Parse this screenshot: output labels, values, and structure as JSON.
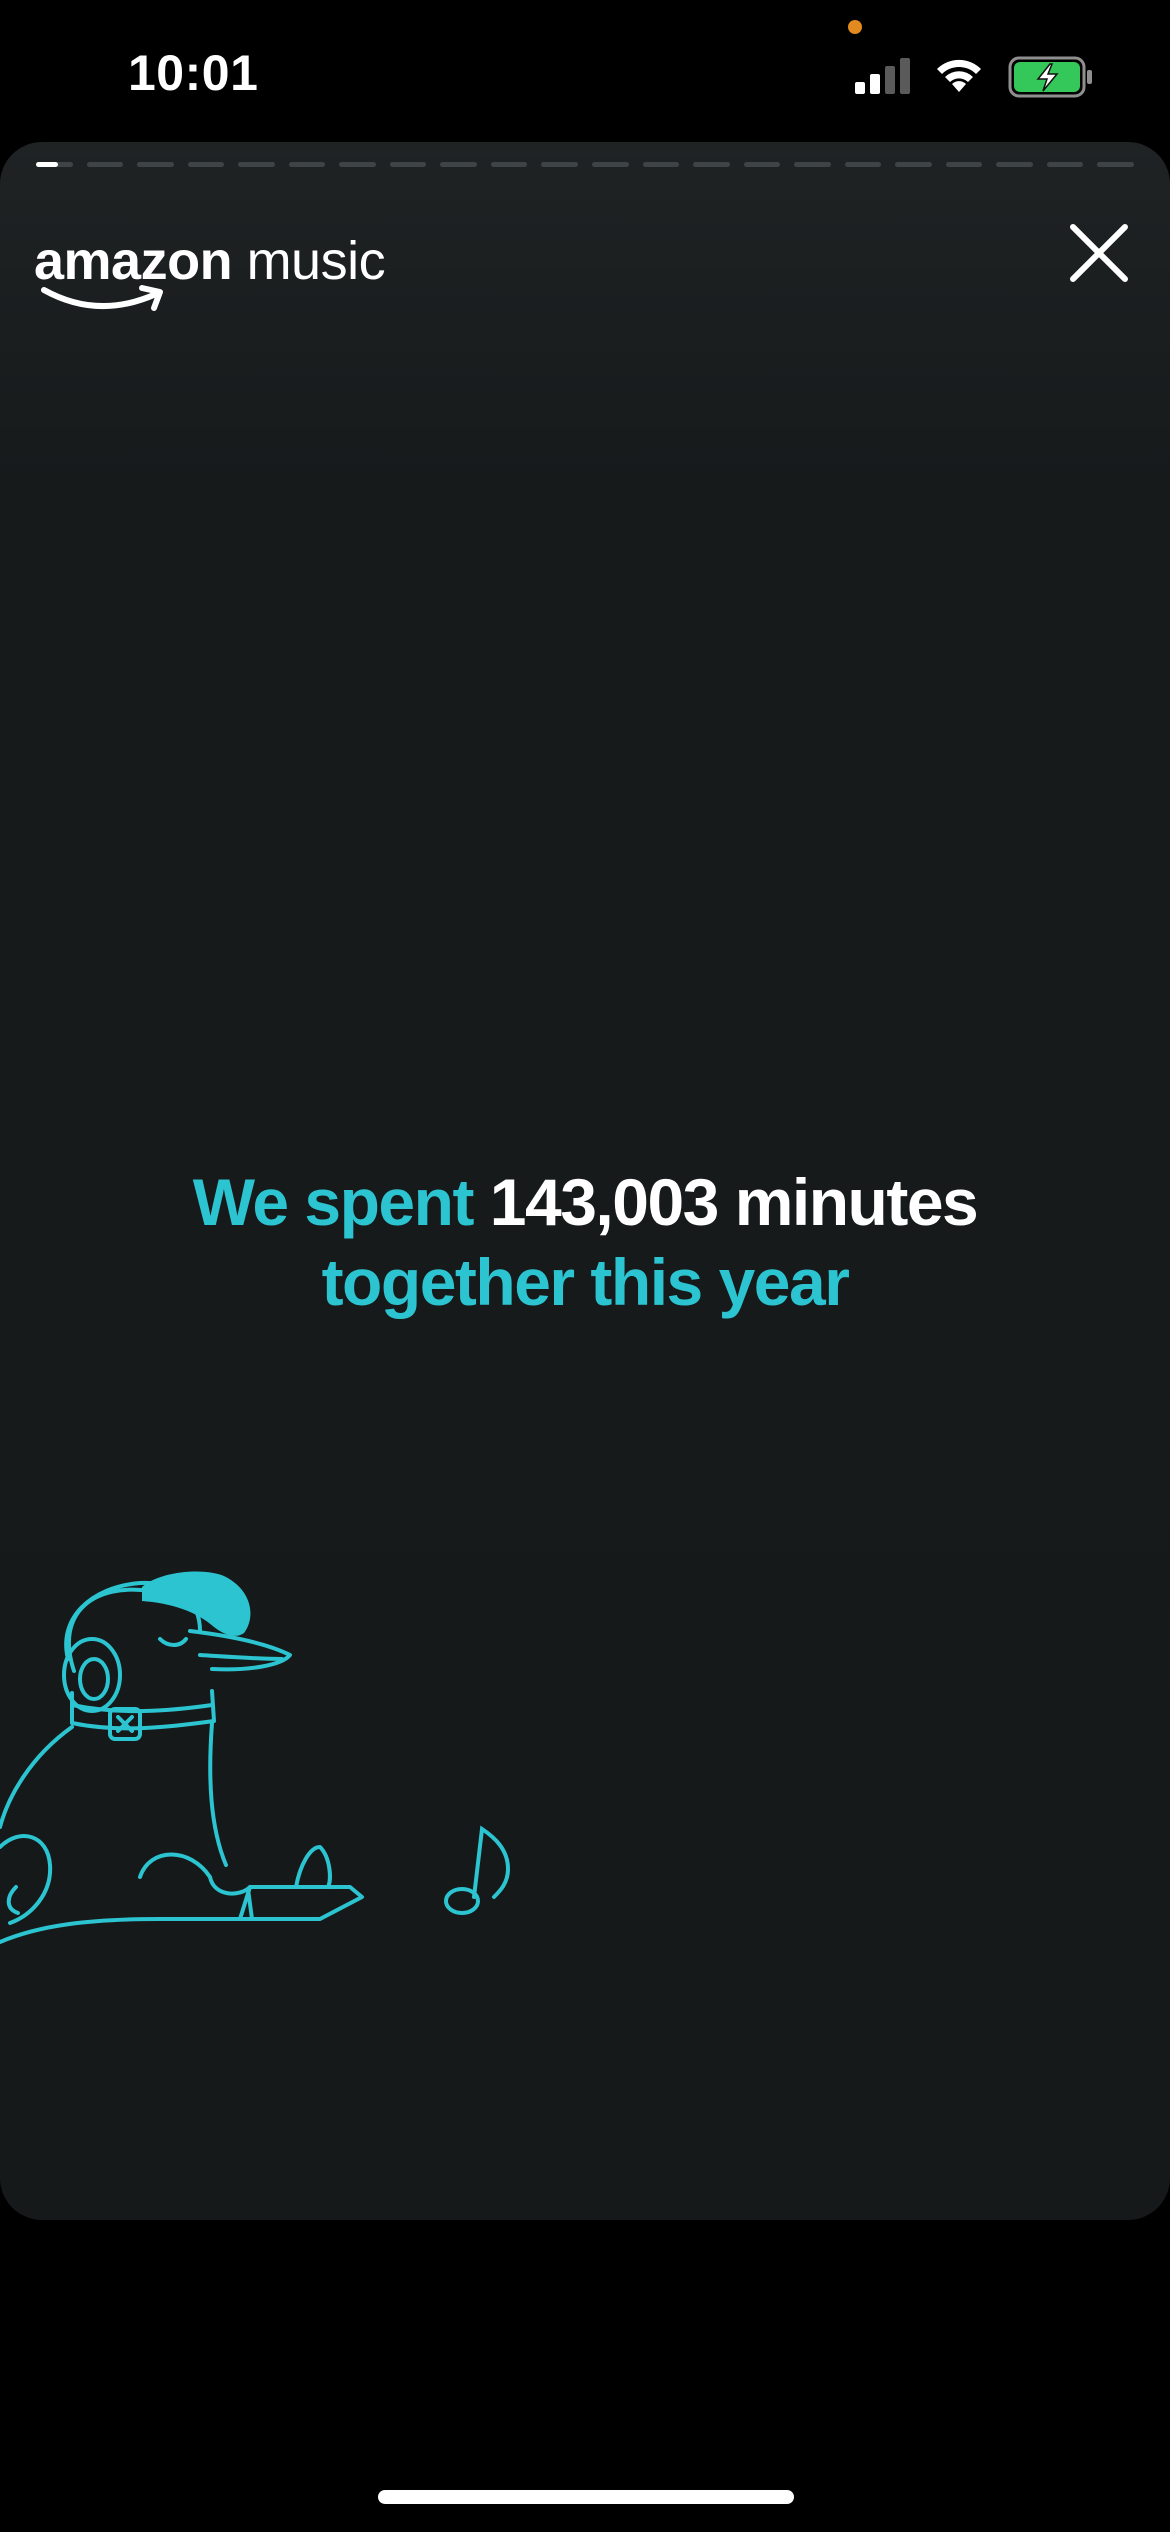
{
  "status_bar": {
    "time": "10:01",
    "icons": [
      "signal-icon",
      "wifi-icon",
      "battery-charging-icon"
    ],
    "signal_bars_filled": 2,
    "signal_bars_total": 4,
    "privacy_indicator_color": "#e28a1f",
    "battery_color": "#34c759"
  },
  "story": {
    "segments_total": 22,
    "active_segment_index": 0,
    "active_segment_progress": 0.6,
    "brand": {
      "name_bold": "amazon",
      "name_light": " music"
    },
    "close_icon": "close-icon",
    "headline": {
      "part1": "We spent ",
      "value": "143,003 minutes",
      "part2": "together this year"
    },
    "illustration": "bird-with-headphones-and-cap",
    "music_note_icon": "music-note-icon"
  },
  "colors": {
    "accent_teal": "#2cc4d0",
    "card_background": "#161a1b",
    "page_background": "#000000",
    "text_white": "#ffffff"
  }
}
